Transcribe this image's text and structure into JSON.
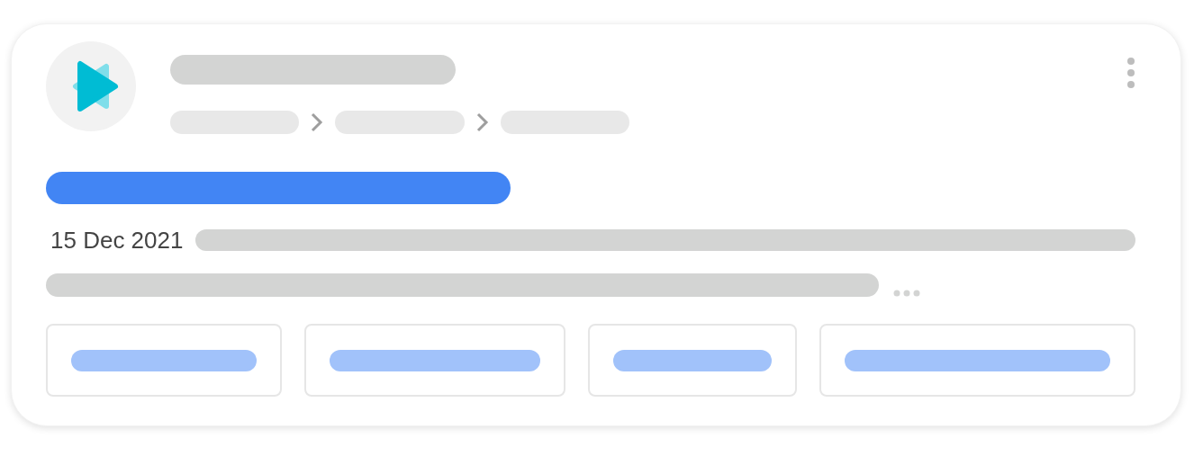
{
  "result": {
    "date": "15 Dec 2021"
  }
}
